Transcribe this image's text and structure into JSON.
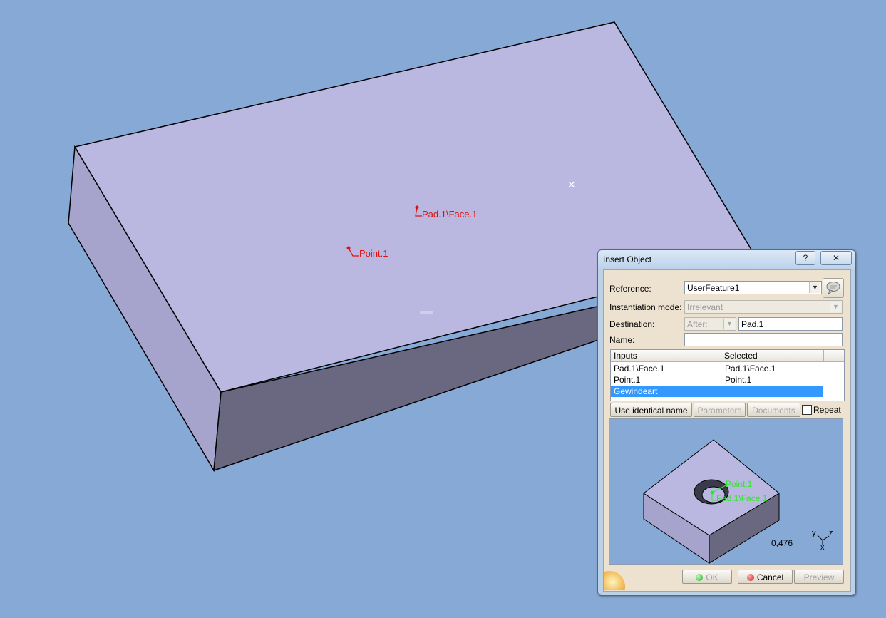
{
  "viewport": {
    "labels": {
      "face": "Pad.1\\Face.1",
      "point": "Point.1"
    },
    "colors": {
      "background": "#87a9d6",
      "top_face": "#bab8e1",
      "side_left": "#a6a4cc",
      "side_front": "#6a6880",
      "label": "#e01010"
    }
  },
  "dialog": {
    "title": "Insert Object",
    "help_icon": "?",
    "close_icon": "✕",
    "reference_label": "Reference:",
    "reference_value": "UserFeature1",
    "instantiation_label": "Instantiation mode:",
    "instantiation_value": "Irrelevant",
    "destination_label": "Destination:",
    "destination_mode": "After:",
    "destination_value": "Pad.1",
    "name_label": "Name:",
    "name_value": "",
    "list": {
      "headers": [
        "Inputs",
        "Selected"
      ],
      "rows": [
        {
          "input": "Pad.1\\Face.1",
          "selected": "Pad.1\\Face.1"
        },
        {
          "input": "Point.1",
          "selected": "Point.1"
        },
        {
          "input": "Gewindeart",
          "selected": ""
        }
      ]
    },
    "buttons": {
      "use_identical_name": "Use identical name",
      "parameters": "Parameters",
      "documents": "Documents",
      "repeat": "Repeat",
      "ok": "OK",
      "cancel": "Cancel",
      "preview": "Preview"
    },
    "preview": {
      "point_label": "Point.1",
      "face_label": "Pad.1\\Face.1",
      "zoom": "0,476",
      "axis_y": "y",
      "axis_z": "z",
      "axis_x": "x"
    }
  }
}
